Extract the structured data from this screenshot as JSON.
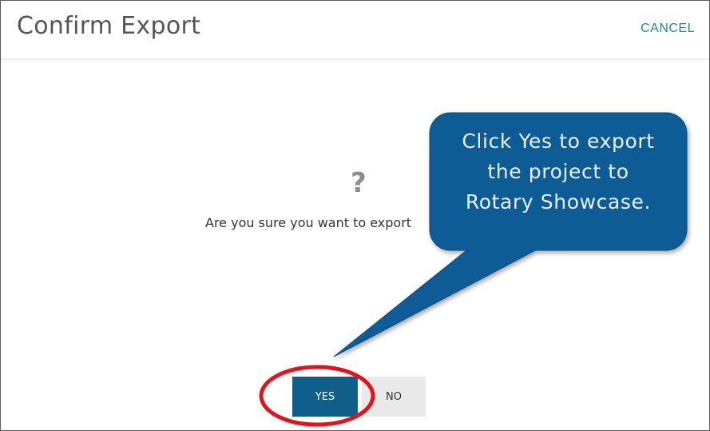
{
  "dialog": {
    "title": "Confirm Export",
    "cancel_label": "CANCEL",
    "question_icon": "?",
    "message": "Are you sure you want to export",
    "buttons": {
      "yes_label": "YES",
      "no_label": "NO"
    }
  },
  "annotation": {
    "callout_lines": [
      "Click Yes to export",
      "the project to",
      "Rotary Showcase."
    ],
    "callout_color": "#0e5b96",
    "highlight_color": "#e0141e"
  },
  "colors": {
    "primary_button": "#0f5f8a",
    "secondary_button": "#e9e9e9",
    "cancel_link": "#1f8a8a"
  }
}
